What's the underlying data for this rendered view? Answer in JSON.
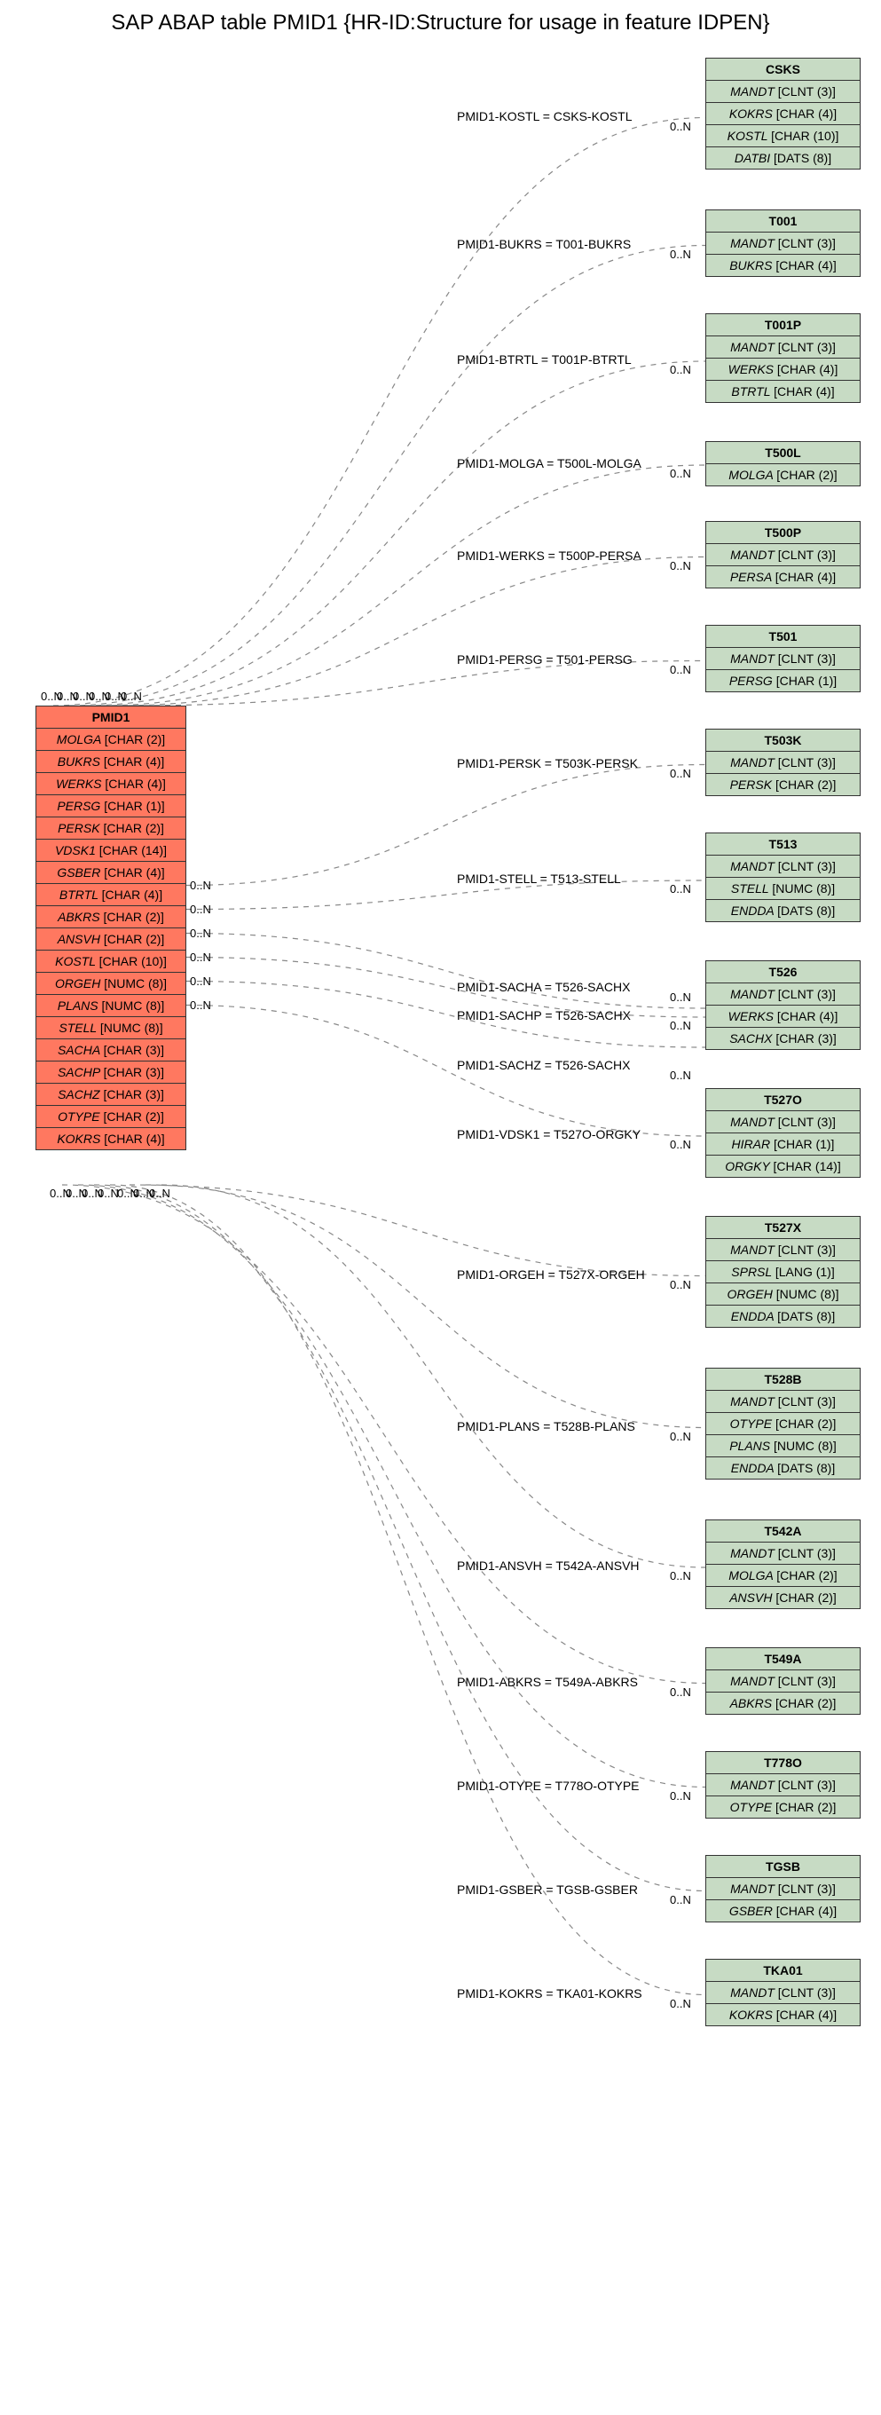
{
  "title": "SAP ABAP table PMID1 {HR-ID:Structure for usage in feature IDPEN}",
  "mainEntity": {
    "name": "PMID1",
    "fields": [
      {
        "field": "MOLGA",
        "type": "[CHAR (2)]"
      },
      {
        "field": "BUKRS",
        "type": "[CHAR (4)]"
      },
      {
        "field": "WERKS",
        "type": "[CHAR (4)]"
      },
      {
        "field": "PERSG",
        "type": "[CHAR (1)]"
      },
      {
        "field": "PERSK",
        "type": "[CHAR (2)]"
      },
      {
        "field": "VDSK1",
        "type": "[CHAR (14)]"
      },
      {
        "field": "GSBER",
        "type": "[CHAR (4)]"
      },
      {
        "field": "BTRTL",
        "type": "[CHAR (4)]"
      },
      {
        "field": "ABKRS",
        "type": "[CHAR (2)]"
      },
      {
        "field": "ANSVH",
        "type": "[CHAR (2)]"
      },
      {
        "field": "KOSTL",
        "type": "[CHAR (10)]"
      },
      {
        "field": "ORGEH",
        "type": "[NUMC (8)]"
      },
      {
        "field": "PLANS",
        "type": "[NUMC (8)]"
      },
      {
        "field": "STELL",
        "type": "[NUMC (8)]"
      },
      {
        "field": "SACHA",
        "type": "[CHAR (3)]"
      },
      {
        "field": "SACHP",
        "type": "[CHAR (3)]"
      },
      {
        "field": "SACHZ",
        "type": "[CHAR (3)]"
      },
      {
        "field": "OTYPE",
        "type": "[CHAR (2)]"
      },
      {
        "field": "KOKRS",
        "type": "[CHAR (4)]"
      }
    ]
  },
  "relatedEntities": [
    {
      "name": "CSKS",
      "fields": [
        {
          "field": "MANDT",
          "type": "[CLNT (3)]"
        },
        {
          "field": "KOKRS",
          "type": "[CHAR (4)]"
        },
        {
          "field": "KOSTL",
          "type": "[CHAR (10)]"
        },
        {
          "field": "DATBI",
          "type": "[DATS (8)]"
        }
      ]
    },
    {
      "name": "T001",
      "fields": [
        {
          "field": "MANDT",
          "type": "[CLNT (3)]"
        },
        {
          "field": "BUKRS",
          "type": "[CHAR (4)]"
        }
      ]
    },
    {
      "name": "T001P",
      "fields": [
        {
          "field": "MANDT",
          "type": "[CLNT (3)]"
        },
        {
          "field": "WERKS",
          "type": "[CHAR (4)]"
        },
        {
          "field": "BTRTL",
          "type": "[CHAR (4)]"
        }
      ]
    },
    {
      "name": "T500L",
      "fields": [
        {
          "field": "MOLGA",
          "type": "[CHAR (2)]"
        }
      ]
    },
    {
      "name": "T500P",
      "fields": [
        {
          "field": "MANDT",
          "type": "[CLNT (3)]"
        },
        {
          "field": "PERSA",
          "type": "[CHAR (4)]"
        }
      ]
    },
    {
      "name": "T501",
      "fields": [
        {
          "field": "MANDT",
          "type": "[CLNT (3)]"
        },
        {
          "field": "PERSG",
          "type": "[CHAR (1)]"
        }
      ]
    },
    {
      "name": "T503K",
      "fields": [
        {
          "field": "MANDT",
          "type": "[CLNT (3)]"
        },
        {
          "field": "PERSK",
          "type": "[CHAR (2)]"
        }
      ]
    },
    {
      "name": "T513",
      "fields": [
        {
          "field": "MANDT",
          "type": "[CLNT (3)]"
        },
        {
          "field": "STELL",
          "type": "[NUMC (8)]"
        },
        {
          "field": "ENDDA",
          "type": "[DATS (8)]"
        }
      ]
    },
    {
      "name": "T526",
      "fields": [
        {
          "field": "MANDT",
          "type": "[CLNT (3)]"
        },
        {
          "field": "WERKS",
          "type": "[CHAR (4)]"
        },
        {
          "field": "SACHX",
          "type": "[CHAR (3)]"
        }
      ]
    },
    {
      "name": "T527O",
      "fields": [
        {
          "field": "MANDT",
          "type": "[CLNT (3)]"
        },
        {
          "field": "HIRAR",
          "type": "[CHAR (1)]"
        },
        {
          "field": "ORGKY",
          "type": "[CHAR (14)]"
        }
      ]
    },
    {
      "name": "T527X",
      "fields": [
        {
          "field": "MANDT",
          "type": "[CLNT (3)]"
        },
        {
          "field": "SPRSL",
          "type": "[LANG (1)]"
        },
        {
          "field": "ORGEH",
          "type": "[NUMC (8)]"
        },
        {
          "field": "ENDDA",
          "type": "[DATS (8)]"
        }
      ]
    },
    {
      "name": "T528B",
      "fields": [
        {
          "field": "MANDT",
          "type": "[CLNT (3)]"
        },
        {
          "field": "OTYPE",
          "type": "[CHAR (2)]"
        },
        {
          "field": "PLANS",
          "type": "[NUMC (8)]"
        },
        {
          "field": "ENDDA",
          "type": "[DATS (8)]"
        }
      ]
    },
    {
      "name": "T542A",
      "fields": [
        {
          "field": "MANDT",
          "type": "[CLNT (3)]"
        },
        {
          "field": "MOLGA",
          "type": "[CHAR (2)]"
        },
        {
          "field": "ANSVH",
          "type": "[CHAR (2)]"
        }
      ]
    },
    {
      "name": "T549A",
      "fields": [
        {
          "field": "MANDT",
          "type": "[CLNT (3)]"
        },
        {
          "field": "ABKRS",
          "type": "[CHAR (2)]"
        }
      ]
    },
    {
      "name": "T778O",
      "fields": [
        {
          "field": "MANDT",
          "type": "[CLNT (3)]"
        },
        {
          "field": "OTYPE",
          "type": "[CHAR (2)]"
        }
      ]
    },
    {
      "name": "TGSB",
      "fields": [
        {
          "field": "MANDT",
          "type": "[CLNT (3)]"
        },
        {
          "field": "GSBER",
          "type": "[CHAR (4)]"
        }
      ]
    },
    {
      "name": "TKA01",
      "fields": [
        {
          "field": "MANDT",
          "type": "[CLNT (3)]"
        },
        {
          "field": "KOKRS",
          "type": "[CHAR (4)]"
        }
      ]
    }
  ],
  "edgeLabels": [
    "PMID1-KOSTL = CSKS-KOSTL",
    "PMID1-BUKRS = T001-BUKRS",
    "PMID1-BTRTL = T001P-BTRTL",
    "PMID1-MOLGA = T500L-MOLGA",
    "PMID1-WERKS = T500P-PERSA",
    "PMID1-PERSG = T501-PERSG",
    "PMID1-PERSK = T503K-PERSK",
    "PMID1-STELL = T513-STELL",
    "PMID1-SACHA = T526-SACHX",
    "PMID1-SACHP = T526-SACHX",
    "PMID1-SACHZ = T526-SACHX",
    "PMID1-VDSK1 = T527O-ORGKY",
    "PMID1-ORGEH = T527X-ORGEH",
    "PMID1-PLANS = T528B-PLANS",
    "PMID1-ANSVH = T542A-ANSVH",
    "PMID1-ABKRS = T549A-ABKRS",
    "PMID1-OTYPE = T778O-OTYPE",
    "PMID1-GSBER = TGSB-GSBER",
    "PMID1-KOKRS = TKA01-KOKRS"
  ],
  "cardinality": "0..N",
  "chart_data": {
    "type": "entity-relationship",
    "centerEntity": "PMID1",
    "relations": [
      {
        "from": "PMID1",
        "fromField": "KOSTL",
        "to": "CSKS",
        "toField": "KOSTL",
        "fromCard": "0..N",
        "toCard": "0..N"
      },
      {
        "from": "PMID1",
        "fromField": "BUKRS",
        "to": "T001",
        "toField": "BUKRS",
        "fromCard": "0..N",
        "toCard": "0..N"
      },
      {
        "from": "PMID1",
        "fromField": "BTRTL",
        "to": "T001P",
        "toField": "BTRTL",
        "fromCard": "0..N",
        "toCard": "0..N"
      },
      {
        "from": "PMID1",
        "fromField": "MOLGA",
        "to": "T500L",
        "toField": "MOLGA",
        "fromCard": "0..N",
        "toCard": "0..N"
      },
      {
        "from": "PMID1",
        "fromField": "WERKS",
        "to": "T500P",
        "toField": "PERSA",
        "fromCard": "0..N",
        "toCard": "0..N"
      },
      {
        "from": "PMID1",
        "fromField": "PERSG",
        "to": "T501",
        "toField": "PERSG",
        "fromCard": "0..N",
        "toCard": "0..N"
      },
      {
        "from": "PMID1",
        "fromField": "PERSK",
        "to": "T503K",
        "toField": "PERSK",
        "fromCard": "0..N",
        "toCard": "0..N"
      },
      {
        "from": "PMID1",
        "fromField": "STELL",
        "to": "T513",
        "toField": "STELL",
        "fromCard": "0..N",
        "toCard": "0..N"
      },
      {
        "from": "PMID1",
        "fromField": "SACHA",
        "to": "T526",
        "toField": "SACHX",
        "fromCard": "0..N",
        "toCard": "0..N"
      },
      {
        "from": "PMID1",
        "fromField": "SACHP",
        "to": "T526",
        "toField": "SACHX",
        "fromCard": "0..N",
        "toCard": "0..N"
      },
      {
        "from": "PMID1",
        "fromField": "SACHZ",
        "to": "T526",
        "toField": "SACHX",
        "fromCard": "0..N",
        "toCard": "0..N"
      },
      {
        "from": "PMID1",
        "fromField": "VDSK1",
        "to": "T527O",
        "toField": "ORGKY",
        "fromCard": "0..N",
        "toCard": "0..N"
      },
      {
        "from": "PMID1",
        "fromField": "ORGEH",
        "to": "T527X",
        "toField": "ORGEH",
        "fromCard": "0..N",
        "toCard": "0..N"
      },
      {
        "from": "PMID1",
        "fromField": "PLANS",
        "to": "T528B",
        "toField": "PLANS",
        "fromCard": "0..N",
        "toCard": "0..N"
      },
      {
        "from": "PMID1",
        "fromField": "ANSVH",
        "to": "T542A",
        "toField": "ANSVH",
        "fromCard": "0..N",
        "toCard": "0..N"
      },
      {
        "from": "PMID1",
        "fromField": "ABKRS",
        "to": "T549A",
        "toField": "ABKRS",
        "fromCard": "0..N",
        "toCard": "0..N"
      },
      {
        "from": "PMID1",
        "fromField": "OTYPE",
        "to": "T778O",
        "toField": "OTYPE",
        "fromCard": "0..N",
        "toCard": "0..N"
      },
      {
        "from": "PMID1",
        "fromField": "GSBER",
        "to": "TGSB",
        "toField": "GSBER",
        "fromCard": "0..N",
        "toCard": "0..N"
      },
      {
        "from": "PMID1",
        "fromField": "KOKRS",
        "to": "TKA01",
        "toField": "KOKRS",
        "fromCard": "0..N",
        "toCard": "0..N"
      }
    ]
  }
}
